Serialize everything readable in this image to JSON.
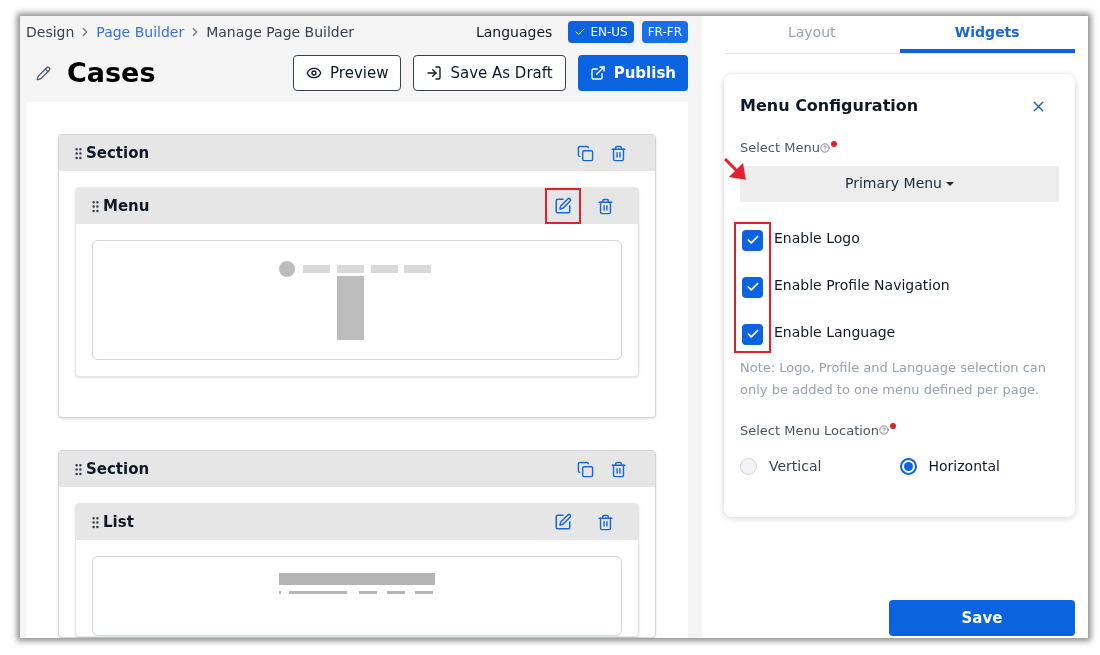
{
  "breadcrumb": [
    {
      "label": "Design",
      "kind": "text"
    },
    {
      "label": "Page Builder",
      "kind": "link"
    },
    {
      "label": "Manage Page Builder",
      "kind": "text"
    }
  ],
  "languages": {
    "label": "Languages",
    "items": [
      {
        "label": "EN-US",
        "selected": true
      },
      {
        "label": "FR-FR",
        "selected": false
      }
    ]
  },
  "page_title": "Cases",
  "actions": [
    {
      "label": "Preview",
      "kind": "outline"
    },
    {
      "label": "Save As Draft",
      "kind": "outline"
    },
    {
      "label": "Publish",
      "kind": "primary"
    }
  ],
  "sections": [
    {
      "title": "Section",
      "widgets": [
        {
          "title": "Menu",
          "kind": "menu",
          "highlighted": true
        }
      ]
    },
    {
      "title": "Section",
      "widgets": [
        {
          "title": "List",
          "kind": "list",
          "highlighted": false
        }
      ]
    }
  ],
  "tabs": [
    {
      "label": "Layout",
      "selected": false
    },
    {
      "label": "Widgets",
      "selected": true
    }
  ],
  "panel": {
    "title": "Menu Configuration",
    "select_menu": {
      "label": "Select Menu",
      "required": true,
      "value": "Primary Menu"
    },
    "checkboxes": [
      {
        "label": "Enable Logo",
        "checked": true
      },
      {
        "label": "Enable Profile Navigation",
        "checked": true
      },
      {
        "label": "Enable Language",
        "checked": true
      }
    ],
    "note": "Note: Logo, Profile and Language selection can only be added to one menu defined per page.",
    "location": {
      "label": "Select Menu Location",
      "required": true,
      "options": [
        {
          "label": "Vertical",
          "selected": false
        },
        {
          "label": "Horizontal",
          "selected": true
        }
      ]
    }
  },
  "save_button": "Save"
}
